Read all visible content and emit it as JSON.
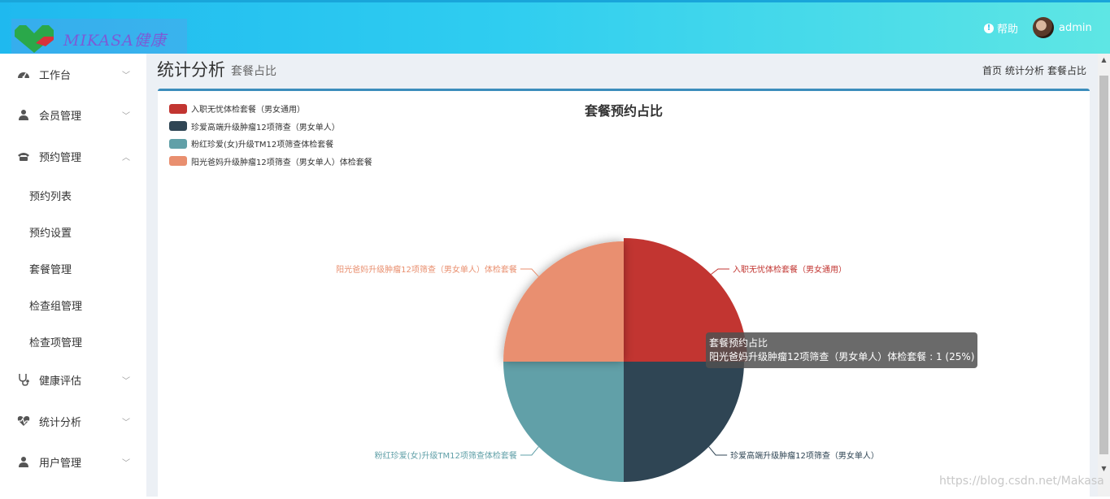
{
  "header": {
    "logo_text": "MIKASA健康",
    "help_label": "帮助",
    "user_name": "admin"
  },
  "sidebar": {
    "items": [
      {
        "label": "工作台",
        "icon": "dashboard-icon",
        "expanded": false
      },
      {
        "label": "会员管理",
        "icon": "user-icon",
        "expanded": false
      },
      {
        "label": "预约管理",
        "icon": "phone-icon",
        "expanded": true
      },
      {
        "label": "健康评估",
        "icon": "stethoscope-icon",
        "expanded": false
      },
      {
        "label": "统计分析",
        "icon": "heartbeat-icon",
        "expanded": false
      },
      {
        "label": "用户管理",
        "icon": "user-icon",
        "expanded": false
      }
    ],
    "sub_items": [
      "预约列表",
      "预约设置",
      "套餐管理",
      "检查组管理",
      "检查项管理"
    ]
  },
  "page": {
    "title": "统计分析",
    "subtitle": "套餐占比",
    "breadcrumb": [
      "首页",
      "统计分析",
      "套餐占比"
    ]
  },
  "chart_data": {
    "type": "pie",
    "title": "套餐预约占比",
    "legend_position": "top-left",
    "categories": [
      "入职无忧体检套餐（男女通用）",
      "珍爱高端升级肿瘤12项筛查（男女单人）",
      "粉红珍爱(女)升级TM12项筛查体检套餐",
      "阳光爸妈升级肿瘤12项筛查（男女单人）体检套餐"
    ],
    "values": [
      1,
      1,
      1,
      1
    ],
    "colors": [
      "#c23531",
      "#2f4554",
      "#61a0a8",
      "#e98f6f"
    ]
  },
  "tooltip": {
    "title": "套餐预约占比",
    "line": "阳光爸妈升级肿瘤12项筛查（男女单人）体检套餐 : 1 (25%)"
  },
  "watermark": "https://blog.csdn.net/Makasa",
  "colors": {
    "accent": "#3c8dbc",
    "header_start": "#1fb9ef",
    "header_end": "#5ee6e4"
  }
}
